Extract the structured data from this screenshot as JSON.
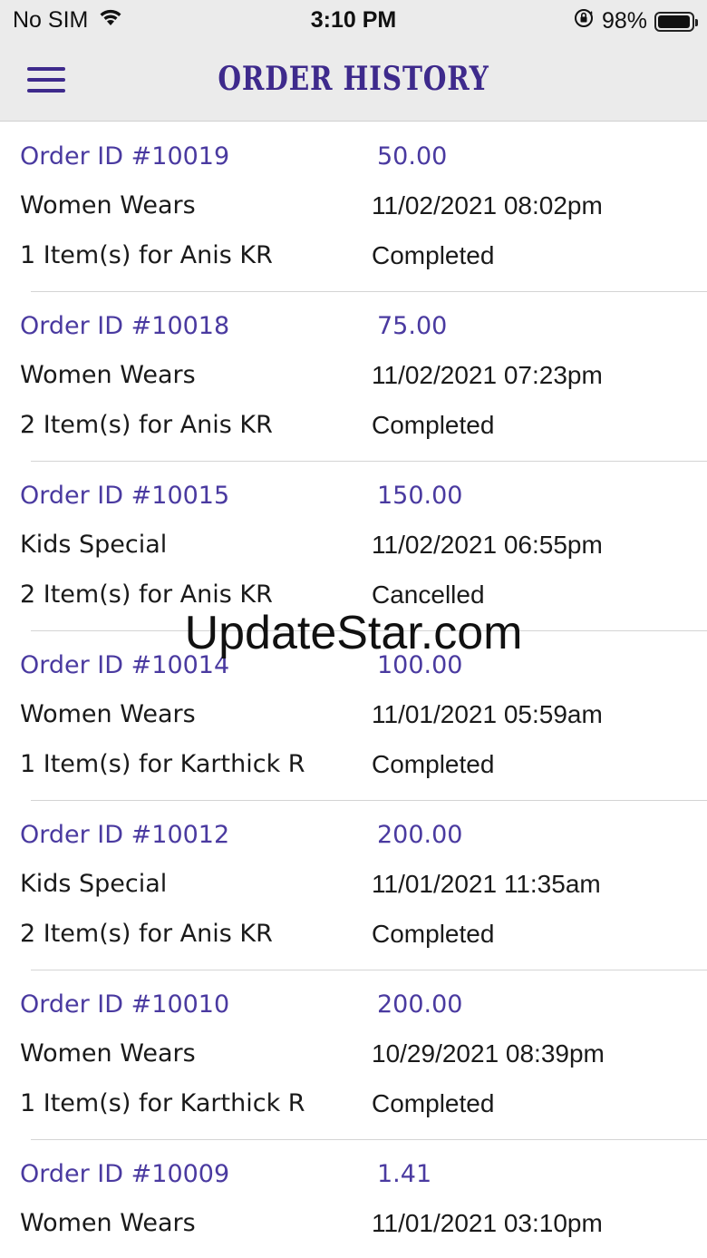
{
  "status_bar": {
    "carrier": "No SIM",
    "time": "3:10 PM",
    "battery_percent": "98%",
    "battery_level": 0.98,
    "icons": [
      "wifi-icon",
      "orientation-lock-icon",
      "battery-icon"
    ]
  },
  "nav": {
    "title": "ORDER HISTORY",
    "menu_icon": "hamburger-menu-icon"
  },
  "colors": {
    "accent": "#4a3aa0",
    "nav_background": "#ebebeb",
    "divider": "#d4d4d4"
  },
  "orders": [
    {
      "order_id": "Order ID #10019",
      "amount": "50.00",
      "category": "Women Wears",
      "date": "11/02/2021 08:02pm",
      "items": "1 Item(s) for Anis KR",
      "status": "Completed"
    },
    {
      "order_id": "Order ID #10018",
      "amount": "75.00",
      "category": "Women Wears",
      "date": "11/02/2021 07:23pm",
      "items": "2 Item(s) for Anis KR",
      "status": "Completed"
    },
    {
      "order_id": "Order ID #10015",
      "amount": "150.00",
      "category": "Kids Special",
      "date": "11/02/2021 06:55pm",
      "items": "2 Item(s) for Anis KR",
      "status": "Cancelled"
    },
    {
      "order_id": "Order ID #10014",
      "amount": "100.00",
      "category": "Women Wears",
      "date": "11/01/2021 05:59am",
      "items": "1 Item(s) for Karthick R",
      "status": "Completed"
    },
    {
      "order_id": "Order ID #10012",
      "amount": "200.00",
      "category": "Kids Special",
      "date": "11/01/2021 11:35am",
      "items": "2 Item(s) for Anis KR",
      "status": "Completed"
    },
    {
      "order_id": "Order ID #10010",
      "amount": "200.00",
      "category": "Women Wears",
      "date": "10/29/2021 08:39pm",
      "items": "1 Item(s) for Karthick R",
      "status": "Completed"
    },
    {
      "order_id": "Order ID #10009",
      "amount": "1.41",
      "category": "Women Wears",
      "date": "11/01/2021 03:10pm",
      "items": "",
      "status": ""
    }
  ],
  "watermark": "UpdateStar.com"
}
